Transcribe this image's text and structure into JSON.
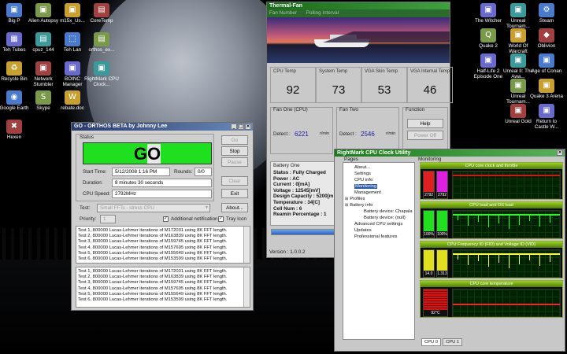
{
  "desktop": {
    "left_icons": [
      [
        "Big P",
        "Alien Autopsy",
        "m15x_Us...",
        "CoreTemp"
      ],
      [
        "Teh Tubes",
        "cpuz_144",
        "Teh Lan",
        "orthos_ex..."
      ],
      [
        "Recycle Bin",
        "Network Stumbler",
        "BOINC Manager",
        "RightMark CPU Clock..."
      ],
      [
        "Google Earth",
        "Skype",
        "rebate.doc"
      ],
      [
        "Hexen"
      ]
    ],
    "right_icons": [
      [
        "The Witcher",
        "Unreal Tournam...",
        "Steam"
      ],
      [
        "Quake 2",
        "World Of Warcraft",
        "Oblivion"
      ],
      [
        "Half-Life 2 Episode One",
        "Unreal II: The Awa...",
        "Age of Conan"
      ],
      [
        "Unreal Tournam...",
        "Quake 3 Arena"
      ],
      [
        "Unreal Gold",
        "Return to Castle W..."
      ]
    ]
  },
  "thermalfan": {
    "title": "Thermal-Fan",
    "menu": [
      "Fan Number",
      "Polling Interval"
    ],
    "temps": [
      {
        "label": "CPU Temp",
        "value": "92"
      },
      {
        "label": "System Temp",
        "value": "73"
      },
      {
        "label": "VGA Skin Temp",
        "value": "53"
      },
      {
        "label": "VGA Internal Temp",
        "value": "46"
      }
    ],
    "fan_one": {
      "label": "Fan One (CPU)",
      "detect": "Detect :",
      "value": "6221",
      "unit": "r/min"
    },
    "fan_two": {
      "label": "Fan Two",
      "detect": "Detect :",
      "value": "2546",
      "unit": "r/min"
    },
    "function": {
      "label": "Function",
      "help": "Help",
      "power_off": "Power Off"
    },
    "battery": {
      "label": "Battery One",
      "lines": [
        "Status : Fully Charged",
        "Power : AC",
        "Current : 0[mA]",
        "Voltage : 12545[mV]",
        "Design Capacity : 5200[m",
        "Temperature : 34[C]",
        "Cell Num : 6",
        "Reamin Percentage : 1"
      ],
      "percent": 1
    },
    "version": "Version : 1.0.0.2"
  },
  "orthos": {
    "title": "GO - ORTHOS BETA by Johnny Lee",
    "status_label": "Status",
    "status_text": "GO",
    "start_label": "Start Time:",
    "start_value": "5/12/2008 1:16 PM",
    "rounds_label": "Rounds:",
    "rounds_value": "0/0",
    "duration_label": "Duration:",
    "duration_value": "8 minutes 30 seconds",
    "speed_label": "CPU Speed:",
    "speed_value": "2792MHz",
    "test_label": "Test:",
    "test_value": "Small FFTs - stress CPU",
    "priority_label": "Priority:",
    "priority_value": "1",
    "additional": "Additional notification",
    "tray": "Tray Icon",
    "buttons": {
      "go": "Go",
      "stop": "Stop",
      "pause": "Pause",
      "clear": "Clear",
      "exit": "Exit",
      "about": "About..."
    },
    "log_lines": [
      "Test 1, 800000 Lucas-Lehmer iterations of M172031 using 8K FFT length.",
      "Test 2, 800000 Lucas-Lehmer iterations of M163839 using 8K FFT length.",
      "Test 3, 800000 Lucas-Lehmer iterations of M159745 using 8K FFT length.",
      "Test 4, 800000 Lucas-Lehmer iterations of M157695 using 8K FFT length.",
      "Test 5, 800000 Lucas-Lehmer iterations of M155649 using 8K FFT length.",
      "Test 6, 800000 Lucas-Lehmer iterations of M153599 using 8K FFT length."
    ]
  },
  "rmclock": {
    "title": "RightMark CPU Clock Utility",
    "pages_label": "Pages",
    "monitoring_label": "Monitoring",
    "tree": [
      "About...",
      "Settings",
      "CPU info",
      "Monitoring",
      "Management",
      "Profiles",
      "Battery info",
      "Battery device: Chapala",
      "Battery device: (null)",
      "Advanced CPU settings",
      "Updates",
      "Professional features"
    ],
    "panels": [
      {
        "title": "CPU core clock and throttle",
        "v1": "2792",
        "v2": "2792"
      },
      {
        "title": "CPU load and OS load",
        "v1": "100%",
        "v2": "100%"
      },
      {
        "title": "CPU Frequency ID (FID) and Voltage ID (VID)",
        "v1": "14.0",
        "v2": "1.313"
      },
      {
        "title": "CPU core temperature",
        "v1": "92°C",
        "v2": ""
      }
    ],
    "tabs": [
      "CPU 0",
      "CPU 1"
    ]
  },
  "colors": {
    "accent_green": "#00e000",
    "orthos_bar": "#2a5a8a",
    "temp_red": "#e00000"
  }
}
